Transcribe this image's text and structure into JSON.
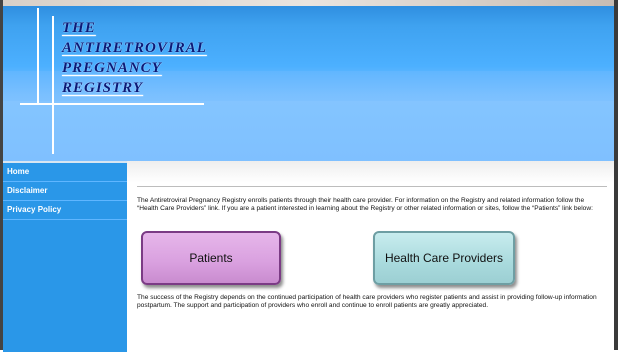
{
  "logo": {
    "lines": [
      "THE",
      "ANTIRETROVIRAL",
      "PREGNANCY",
      "REGISTRY"
    ]
  },
  "sidebar": {
    "items": [
      {
        "label": "Home"
      },
      {
        "label": "Disclaimer"
      },
      {
        "label": "Privacy Policy"
      }
    ]
  },
  "main": {
    "intro": "The Antiretroviral Pregnancy Registry enrolls patients through their health care provider. For information on the Registry and related information follow the “Health Care Providers” link. If you are a patient interested in learning about the Registry or other related information or sites, follow the “Patients” link below:",
    "buttons": {
      "patients": "Patients",
      "providers": "Health Care Providers"
    },
    "closing": "The success of the Registry depends on the continued participation of health care providers who register patients and assist in providing follow-up information postpartum. The support and participation of providers who enroll and continue to enroll patients are greatly appreciated."
  }
}
